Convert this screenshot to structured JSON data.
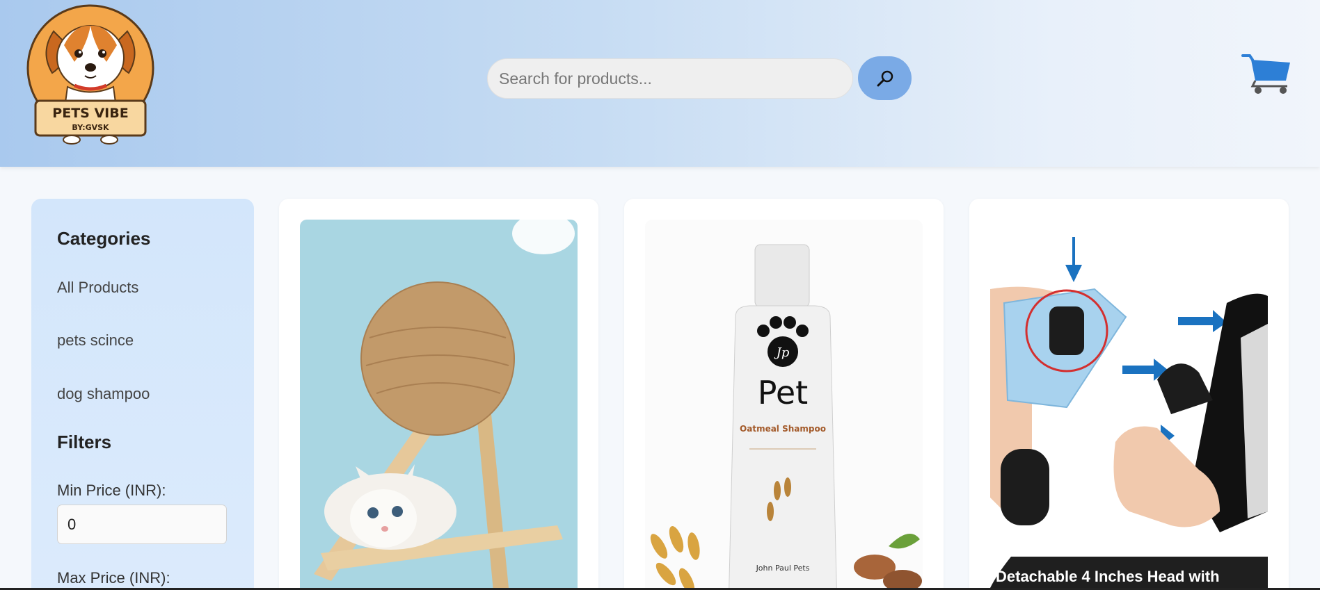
{
  "brand": {
    "logo_title": "PETS VIBE",
    "logo_subtitle": "BY:GVSK"
  },
  "search": {
    "placeholder": "Search for products..."
  },
  "sidebar": {
    "categories_title": "Categories",
    "categories": [
      {
        "label": "All Products"
      },
      {
        "label": "pets scince"
      },
      {
        "label": "dog shampoo"
      }
    ],
    "filters_title": "Filters",
    "min_price_label": "Min Price (INR):",
    "min_price_value": "0",
    "max_price_label": "Max Price (INR):"
  },
  "products": [
    {
      "image": "cat-scratch-ball-toy"
    },
    {
      "image": "jp-pet-oatmeal-shampoo",
      "bottle_brand": "Pet",
      "bottle_text": "Oatmeal Shampoo",
      "bottle_maker": "John Paul Pets"
    },
    {
      "image": "pet-grooming-deshedding-tool",
      "banner": "Detachable 4 Inches Head with"
    }
  ],
  "colors": {
    "header_start": "#a9c9ee",
    "search_button": "#7aaae6",
    "cart": "#2d7fd6",
    "sidebar_bg": "#d3e6fb"
  }
}
